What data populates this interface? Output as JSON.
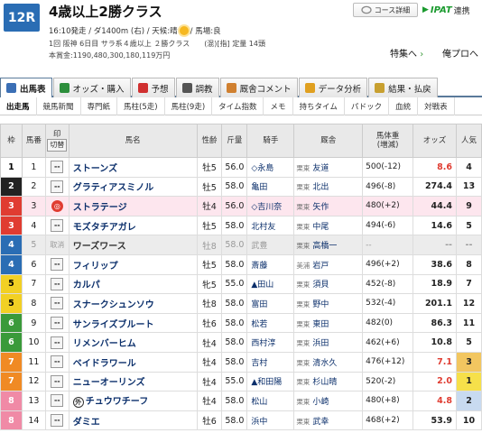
{
  "header": {
    "race_no": "12R",
    "race_name": "4歳以上2勝クラス",
    "info_line1_a": "16:10発走 / ダ1400m (右) / 天候:晴",
    "info_line1_b": "/ 馬場:良",
    "info_line2": "1回 阪神 6日目 サラ系４歳以上 ２勝クラス　　(混)[指] 定量 14頭",
    "info_line3": "本賞金:1190,480,300,180,119万円",
    "course_btn": "コース詳細",
    "ipat_label": "IPAT",
    "ipat_text": "連携",
    "feature_link": "特集へ",
    "compare_link": "俺プロへ"
  },
  "tabs": [
    {
      "label": "出馬表",
      "icon": "table-icon",
      "color": "#3b6fb5"
    },
    {
      "label": "オッズ・購入",
      "icon": "chart-icon",
      "color": "#2d8f3c"
    },
    {
      "label": "予想",
      "icon": "target-icon",
      "color": "#d03030"
    },
    {
      "label": "調教",
      "icon": "stopwatch-icon",
      "color": "#555555"
    },
    {
      "label": "厩舎コメント",
      "icon": "comment-icon",
      "color": "#d08030"
    },
    {
      "label": "データ分析",
      "icon": "bars-icon",
      "color": "#e0a020"
    },
    {
      "label": "結果・払戻",
      "icon": "coins-icon",
      "color": "#c8a030"
    }
  ],
  "subtabs": [
    "出走馬",
    "競馬新聞",
    "専門紙",
    "馬柱(5走)",
    "馬柱(9走)",
    "タイム指数",
    "メモ",
    "持ちタイム",
    "パドック",
    "血統",
    "対戦表"
  ],
  "table": {
    "headers": {
      "waku": "枠",
      "umaban": "馬番",
      "mark": "印",
      "mark_sub": "切替",
      "name": "馬名",
      "sexage": "性齢",
      "weight": "斤量",
      "jockey": "騎手",
      "trainer": "厩舎",
      "body": "馬体重",
      "body_sub": "(増減)",
      "odds": "オッズ",
      "pop": "人気"
    },
    "rows": [
      {
        "waku": "1",
        "umaban": "1",
        "mark": "--",
        "name": "ストーンズ",
        "sexage": "牡5",
        "weight": "56.0",
        "jockey": "◇永島",
        "reg": "栗東",
        "trainer": "友道",
        "body": "500(-12)",
        "odds": "8.6",
        "pop": "4",
        "wcolor": "#ffffff",
        "wtext": "#000000",
        "ored": true
      },
      {
        "waku": "2",
        "umaban": "2",
        "mark": "--",
        "name": "グラティアスミノル",
        "sexage": "牡5",
        "weight": "58.0",
        "jockey": "亀田",
        "reg": "栗東",
        "trainer": "北出",
        "body": "496(-8)",
        "odds": "274.4",
        "pop": "13",
        "wcolor": "#222222",
        "wtext": "#ffffff"
      },
      {
        "waku": "3",
        "umaban": "3",
        "mark": "◎",
        "name": "ストラテージ",
        "sexage": "牡4",
        "weight": "56.0",
        "jockey": "◇吉川奈",
        "reg": "栗東",
        "trainer": "矢作",
        "body": "480(+2)",
        "odds": "44.4",
        "pop": "9",
        "wcolor": "#e03c31",
        "wtext": "#ffffff",
        "hl": true
      },
      {
        "waku": "3",
        "umaban": "4",
        "mark": "--",
        "name": "モズタチアガレ",
        "sexage": "牡5",
        "weight": "58.0",
        "jockey": "北村友",
        "reg": "栗東",
        "trainer": "中尾",
        "body": "494(-6)",
        "odds": "14.6",
        "pop": "5",
        "wcolor": "#e03c31",
        "wtext": "#ffffff"
      },
      {
        "waku": "4",
        "umaban": "5",
        "mark": "取消",
        "name": "ワーズワース",
        "sexage": "牡8",
        "weight": "58.0",
        "jockey": "武豊",
        "reg": "栗東",
        "trainer": "高橋一",
        "body": "--",
        "odds": "--",
        "pop": "--",
        "wcolor": "#2a6db4",
        "wtext": "#ffffff",
        "scratch": true
      },
      {
        "waku": "4",
        "umaban": "6",
        "mark": "--",
        "name": "フィリップ",
        "sexage": "牡5",
        "weight": "58.0",
        "jockey": "斎藤",
        "reg": "美浦",
        "trainer": "岩戸",
        "body": "496(+2)",
        "odds": "38.6",
        "pop": "8",
        "wcolor": "#2a6db4",
        "wtext": "#ffffff"
      },
      {
        "waku": "5",
        "umaban": "7",
        "mark": "--",
        "name": "カルパ",
        "sexage": "牝5",
        "weight": "55.0",
        "jockey": "▲田山",
        "reg": "栗東",
        "trainer": "須貝",
        "body": "452(-8)",
        "odds": "18.9",
        "pop": "7",
        "wcolor": "#f2d024",
        "wtext": "#000000"
      },
      {
        "waku": "5",
        "umaban": "8",
        "mark": "--",
        "name": "スナークシュンソウ",
        "sexage": "牡8",
        "weight": "58.0",
        "jockey": "富田",
        "reg": "栗東",
        "trainer": "野中",
        "body": "532(-4)",
        "odds": "201.1",
        "pop": "12",
        "wcolor": "#f2d024",
        "wtext": "#000000"
      },
      {
        "waku": "6",
        "umaban": "9",
        "mark": "--",
        "name": "サンライズブルート",
        "sexage": "牡6",
        "weight": "58.0",
        "jockey": "松若",
        "reg": "栗東",
        "trainer": "東田",
        "body": "482(0)",
        "odds": "86.3",
        "pop": "11",
        "wcolor": "#3a9a3a",
        "wtext": "#ffffff"
      },
      {
        "waku": "6",
        "umaban": "10",
        "mark": "--",
        "name": "リメンバーヒム",
        "sexage": "牡4",
        "weight": "58.0",
        "jockey": "西村淳",
        "reg": "栗東",
        "trainer": "浜田",
        "body": "462(+6)",
        "odds": "10.8",
        "pop": "5",
        "wcolor": "#3a9a3a",
        "wtext": "#ffffff"
      },
      {
        "waku": "7",
        "umaban": "11",
        "mark": "--",
        "name": "ベイドラワール",
        "sexage": "牡4",
        "weight": "58.0",
        "jockey": "吉村",
        "reg": "栗東",
        "trainer": "清水久",
        "body": "476(+12)",
        "odds": "7.1",
        "pop": "3",
        "wcolor": "#f08a24",
        "wtext": "#ffffff",
        "ored": true,
        "pcolor": "#f2c660"
      },
      {
        "waku": "7",
        "umaban": "12",
        "mark": "--",
        "name": "ニューオーリンズ",
        "sexage": "牡4",
        "weight": "55.0",
        "jockey": "▲和田陽",
        "reg": "栗東",
        "trainer": "杉山晴",
        "body": "520(-2)",
        "odds": "2.0",
        "pop": "1",
        "wcolor": "#f08a24",
        "wtext": "#ffffff",
        "ored": true,
        "pcolor": "#f6e04a"
      },
      {
        "waku": "8",
        "umaban": "13",
        "mark": "--",
        "name": "チュウワチーフ",
        "sexage": "牡4",
        "weight": "58.0",
        "jockey": "松山",
        "reg": "栗東",
        "trainer": "小崎",
        "body": "480(+8)",
        "odds": "4.8",
        "pop": "2",
        "wcolor": "#f08aa6",
        "wtext": "#ffffff",
        "ored": true,
        "pcolor": "#c8daf0",
        "prefix": "外"
      },
      {
        "waku": "8",
        "umaban": "14",
        "mark": "--",
        "name": "ダミエ",
        "sexage": "牡6",
        "weight": "58.0",
        "jockey": "浜中",
        "reg": "栗東",
        "trainer": "武幸",
        "body": "468(+2)",
        "odds": "53.9",
        "pop": "10",
        "wcolor": "#f08aa6",
        "wtext": "#ffffff"
      }
    ]
  }
}
